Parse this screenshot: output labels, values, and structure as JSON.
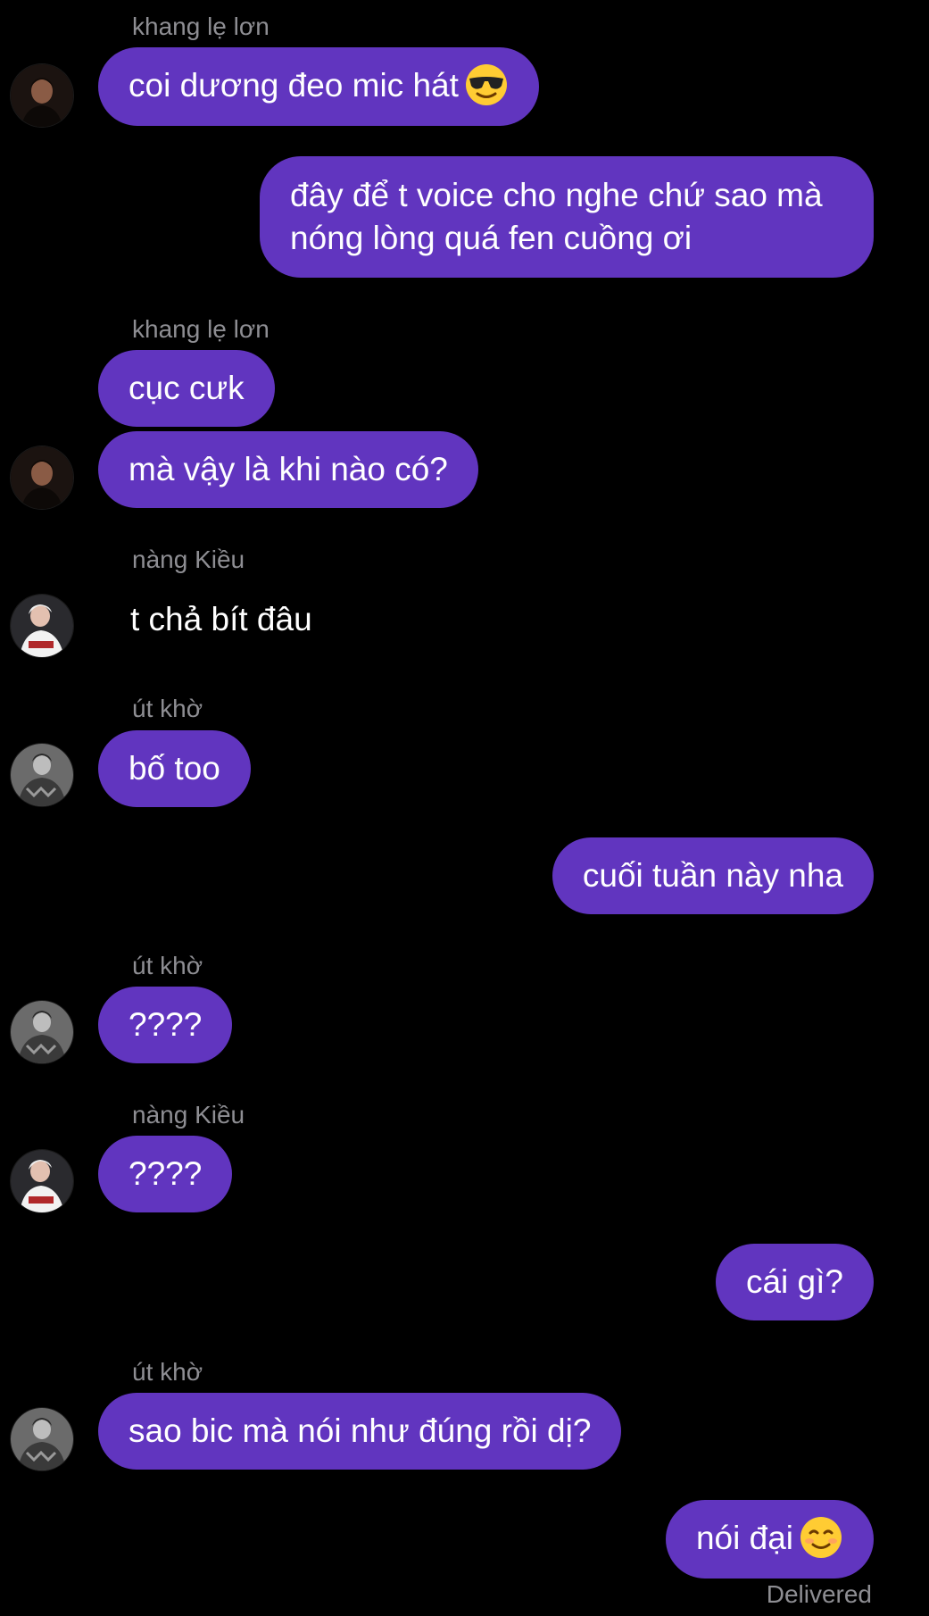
{
  "messages": [
    {
      "sender": "khang lẹ lơn",
      "text": "coi dương đeo mic hát",
      "emoji": "smiling-face-with-sunglasses-emoji"
    },
    {
      "text": "đây để t voice cho nghe chứ sao mà nóng lòng quá fen cuồng ơi"
    },
    {
      "sender": "khang lẹ lơn",
      "text": "cục cưk"
    },
    {
      "text": "mà vậy là khi nào có?"
    },
    {
      "sender": "nàng Kiều",
      "text": "t chả bít đâu"
    },
    {
      "sender": "út khờ",
      "text": "bố too"
    },
    {
      "text": "cuối tuần này nha"
    },
    {
      "sender": "út khờ",
      "text": "????"
    },
    {
      "sender": "nàng Kiều",
      "text": "????"
    },
    {
      "text": "cái gì?"
    },
    {
      "sender": "út khờ",
      "text": "sao bic mà nói như đúng rồi dị?"
    },
    {
      "text": "nói đại",
      "emoji": "smiling-face-emoji"
    }
  ],
  "status": "Delivered",
  "theme": {
    "background": "#000000",
    "bubble": "#6135bf",
    "sender_label": "#8e8e93",
    "text": "#ffffff"
  }
}
